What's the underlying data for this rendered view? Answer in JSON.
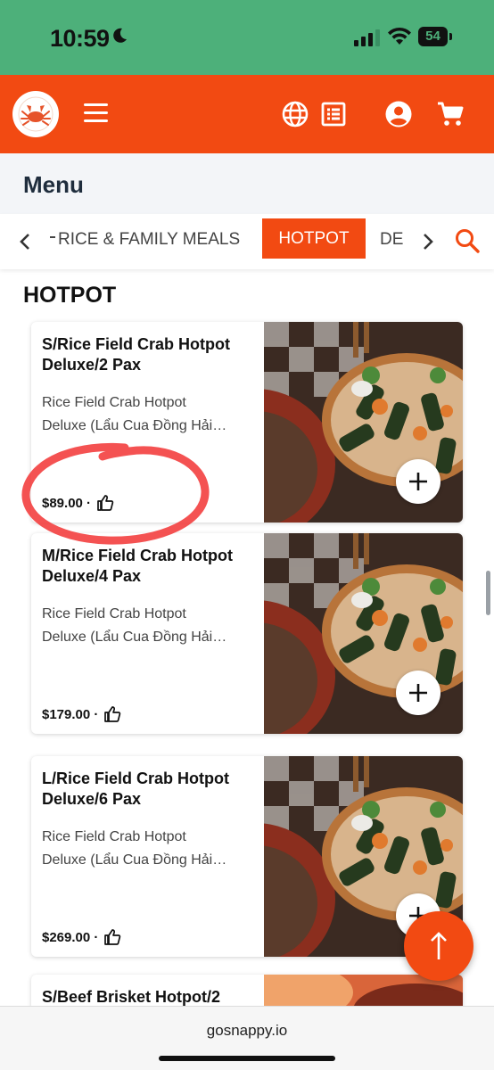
{
  "status_bar": {
    "time": "10:59",
    "battery": "54"
  },
  "header": {
    "logo_icon": "crab-logo-icon",
    "menu_icon": "hamburger-icon",
    "language_icon": "globe-icon",
    "orders_icon": "receipt-list-icon",
    "account_icon": "account-circle-icon",
    "cart_icon": "shopping-cart-icon"
  },
  "page": {
    "title": "Menu"
  },
  "categories": {
    "left_partial": "RICE & FAMILY MEALS",
    "active": "HOTPOT",
    "right_partial": "DE"
  },
  "section": {
    "title": "HOTPOT"
  },
  "items": [
    {
      "name": "S/Rice Field Crab Hotpot Deluxe/2 Pax",
      "desc_line1": "Rice Field Crab Hotpot",
      "desc_line2": "Deluxe (Lẩu Cua Đồng Hải…",
      "price": "$89.00 ·"
    },
    {
      "name": "M/Rice Field Crab Hotpot Deluxe/4 Pax",
      "desc_line1": "Rice Field Crab Hotpot",
      "desc_line2": "Deluxe (Lẩu Cua Đồng Hải…",
      "price": "$179.00 ·"
    },
    {
      "name": "L/Rice Field Crab Hotpot Deluxe/6 Pax",
      "desc_line1": "Rice Field Crab Hotpot",
      "desc_line2": "Deluxe (Lẩu Cua Đồng Hải…",
      "price": "$269.00 ·"
    },
    {
      "name": "S/Beef Brisket Hotpot/2"
    }
  ],
  "browser": {
    "url": "gosnappy.io"
  },
  "colors": {
    "brand": "#f24a12",
    "status_bar": "#4db07a",
    "annotation": "#f23a3a"
  }
}
